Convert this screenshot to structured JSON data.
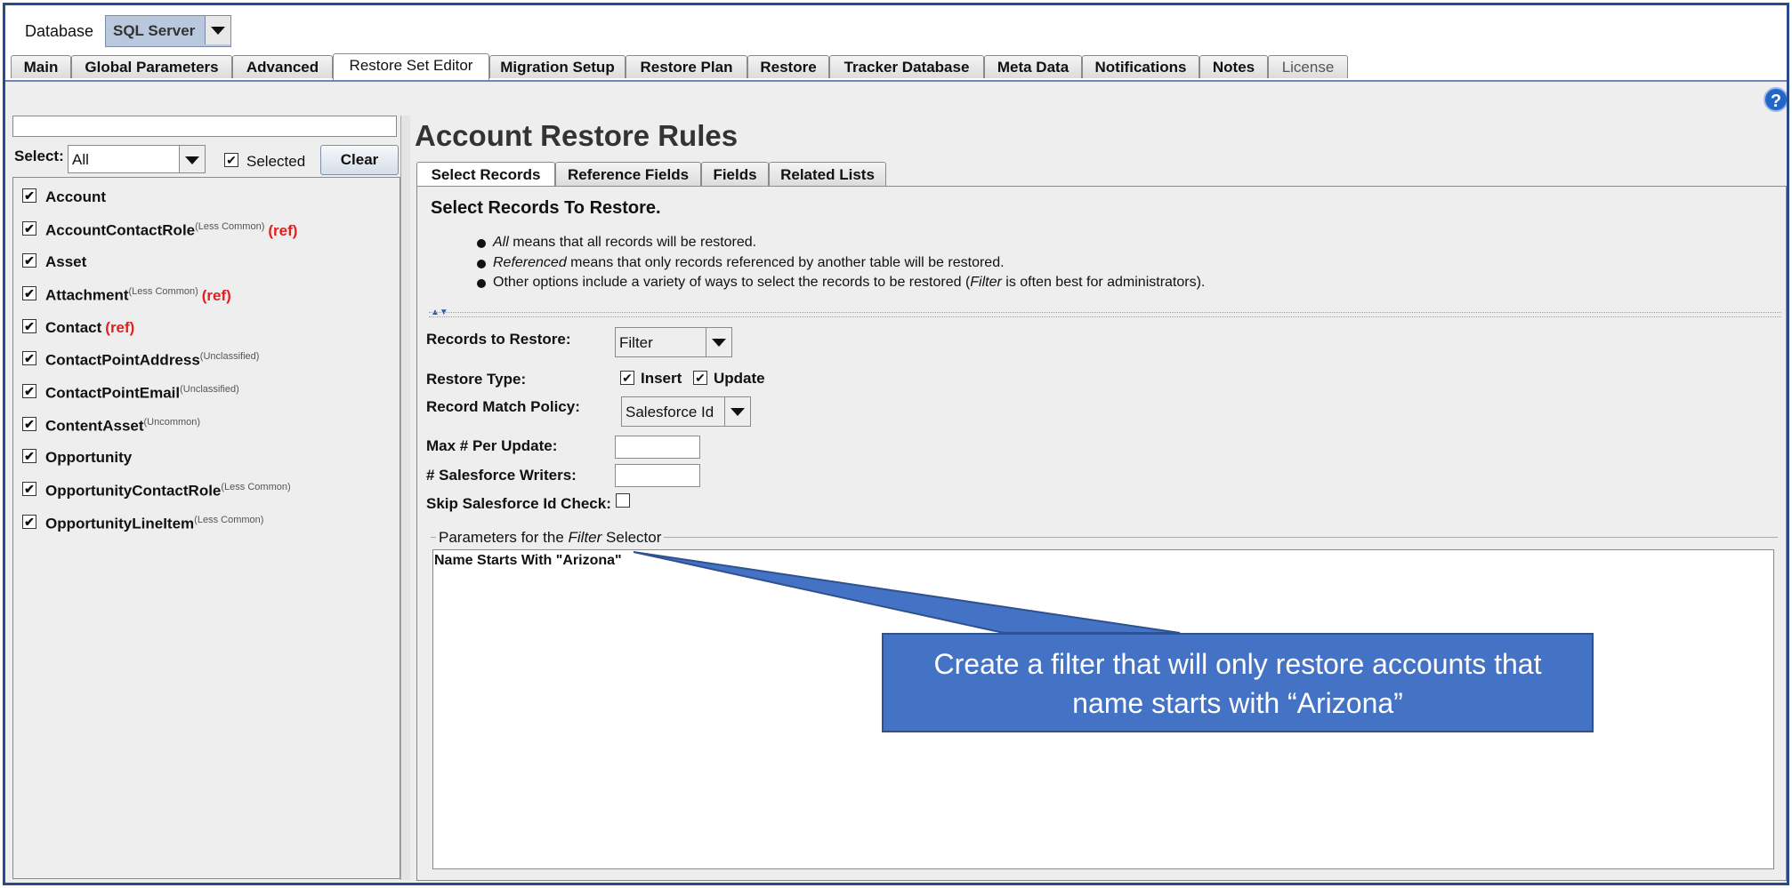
{
  "database": {
    "label": "Database",
    "value": "SQL Server"
  },
  "main_tabs": [
    {
      "label": "Main"
    },
    {
      "label": "Global Parameters"
    },
    {
      "label": "Advanced"
    },
    {
      "label": "Restore Set Editor"
    },
    {
      "label": "Migration Setup"
    },
    {
      "label": "Restore Plan"
    },
    {
      "label": "Restore"
    },
    {
      "label": "Tracker Database"
    },
    {
      "label": "Meta Data"
    },
    {
      "label": "Notifications"
    },
    {
      "label": "Notes"
    },
    {
      "label": "License"
    }
  ],
  "active_main_tab": "Restore Set Editor",
  "help_icon": "?",
  "left_panel": {
    "search_value": "",
    "select_label": "Select:",
    "select_value": "All",
    "selected_label": "Selected",
    "selected_checked": true,
    "clear_label": "Clear",
    "items": [
      {
        "name": "Account",
        "tag": "",
        "ref": "",
        "checked": true
      },
      {
        "name": "AccountContactRole",
        "tag": "(Less Common)",
        "ref": "(ref)",
        "checked": true
      },
      {
        "name": "Asset",
        "tag": "",
        "ref": "",
        "checked": true
      },
      {
        "name": "Attachment",
        "tag": "(Less Common)",
        "ref": "(ref)",
        "checked": true
      },
      {
        "name": "Contact",
        "tag": "",
        "ref": "(ref)",
        "checked": true
      },
      {
        "name": "ContactPointAddress",
        "tag": "(Unclassified)",
        "ref": "",
        "checked": true
      },
      {
        "name": "ContactPointEmail",
        "tag": "(Unclassified)",
        "ref": "",
        "checked": true
      },
      {
        "name": "ContentAsset",
        "tag": "(Uncommon)",
        "ref": "",
        "checked": true
      },
      {
        "name": "Opportunity",
        "tag": "",
        "ref": "",
        "checked": true
      },
      {
        "name": "OpportunityContactRole",
        "tag": "(Less Common)",
        "ref": "",
        "checked": true
      },
      {
        "name": "OpportunityLineItem",
        "tag": "(Less Common)",
        "ref": "",
        "checked": true
      }
    ]
  },
  "right_panel": {
    "title": "Account Restore Rules",
    "sub_tabs": [
      {
        "label": "Select Records"
      },
      {
        "label": "Reference Fields"
      },
      {
        "label": "Fields"
      },
      {
        "label": "Related Lists"
      }
    ],
    "active_sub_tab": "Select Records",
    "section_title": "Select Records To Restore.",
    "bullets": [
      {
        "em": "All",
        "text": " means that all records will be restored."
      },
      {
        "em": "Referenced",
        "text": " means that only records referenced by another table will be restored."
      },
      {
        "pre": "Other options include a variety of ways to select the records to be restored (",
        "em": "Filter",
        "text": " is often best for administrators)."
      }
    ],
    "form": {
      "records_label": "Records to Restore:",
      "records_value": "Filter",
      "restore_type_label": "Restore Type:",
      "insert_label": "Insert",
      "insert_checked": true,
      "update_label": "Update",
      "update_checked": true,
      "match_label": "Record Match Policy:",
      "match_value": "Salesforce Id",
      "max_label": "Max # Per Update:",
      "max_value": "",
      "writers_label": "# Salesforce Writers:",
      "writers_value": "",
      "skip_label": "Skip Salesforce Id Check:",
      "skip_checked": false
    },
    "params": {
      "label_pre": "Parameters for the ",
      "label_em": "Filter",
      "label_post": " Selector",
      "text": "Name Starts With \"Arizona\""
    }
  },
  "callout": {
    "line1": "Create a filter that will only restore accounts that",
    "line2": "name starts with “Arizona”",
    "bg_color": "#4472c4"
  }
}
